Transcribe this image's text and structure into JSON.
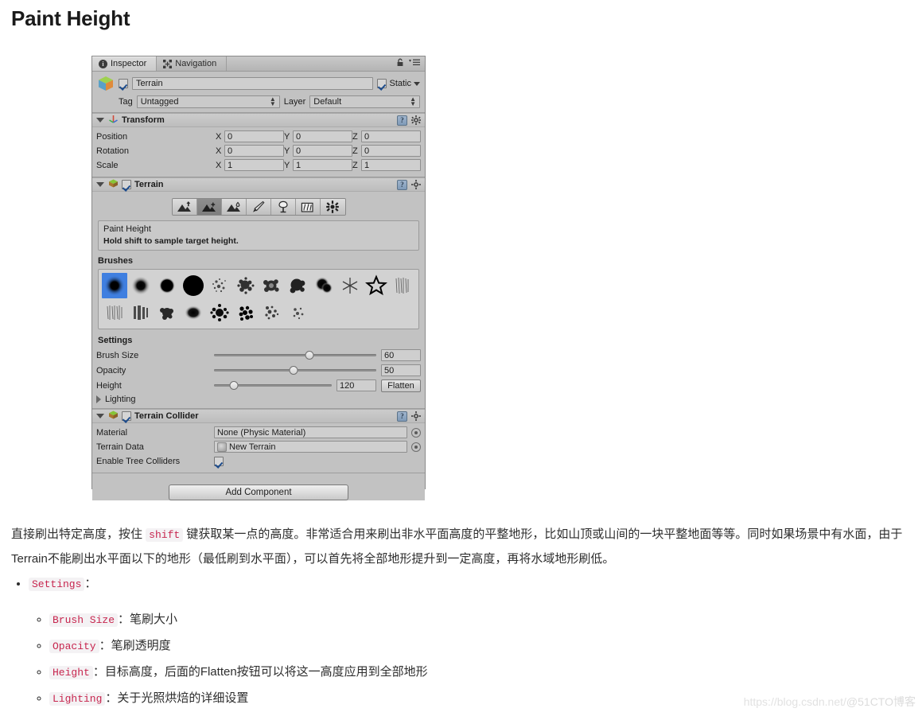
{
  "article": {
    "title": "Paint Height",
    "paragraph_before_code": "直接刷出特定高度，按住 ",
    "paragraph_code": "shift",
    "paragraph_after_code": " 键获取某一点的高度。非常适合用来刷出非水平面高度的平整地形，比如山顶或山间的一块平整地面等等。同时如果场景中有水面，由于Terrain不能刷出水平面以下的地形（最低刷到水平面），可以首先将全部地形提升到一定高度，再将水域地形刷低。",
    "bullets": {
      "top_code": "Settings",
      "top_colon": "：",
      "items": [
        {
          "code": "Brush Size",
          "text": "：笔刷大小"
        },
        {
          "code": "Opacity",
          "text": "：笔刷透明度"
        },
        {
          "code": "Height",
          "text": "：目标高度，后面的Flatten按钮可以将这一高度应用到全部地形"
        },
        {
          "code": "Lighting",
          "text": "：关于光照烘焙的详细设置"
        }
      ]
    },
    "watermark_url": "https://blog.csdn.net/",
    "watermark_brand": "@51CTO博客"
  },
  "inspector": {
    "tabs": [
      {
        "label": "Inspector",
        "icon": "info-icon",
        "active": true
      },
      {
        "label": "Navigation",
        "icon": "navigation-icon",
        "active": false
      }
    ],
    "lock_icon": "lock-icon",
    "menu_icon": "dropdown-menu-icon",
    "object": {
      "enabled": true,
      "name_value": "Terrain",
      "static_label": "Static",
      "static_checked": true,
      "tag_label": "Tag",
      "tag_value": "Untagged",
      "layer_label": "Layer",
      "layer_value": "Default"
    },
    "transform": {
      "title": "Transform",
      "rows": [
        {
          "name": "Position",
          "x": "0",
          "y": "0",
          "z": "0"
        },
        {
          "name": "Rotation",
          "x": "0",
          "y": "0",
          "z": "0"
        },
        {
          "name": "Scale",
          "x": "1",
          "y": "1",
          "z": "1"
        }
      ],
      "axes": [
        "X",
        "Y",
        "Z"
      ]
    },
    "terrain": {
      "title": "Terrain",
      "enabled": true,
      "tools": [
        {
          "name": "raise-lower-terrain-tool",
          "active": false
        },
        {
          "name": "paint-height-tool",
          "active": true
        },
        {
          "name": "smooth-height-tool",
          "active": false
        },
        {
          "name": "paint-texture-tool",
          "active": false
        },
        {
          "name": "place-trees-tool",
          "active": false
        },
        {
          "name": "paint-details-tool",
          "active": false
        },
        {
          "name": "terrain-settings-tool",
          "active": false
        }
      ],
      "help_title": "Paint Height",
      "help_text": "Hold shift to sample target height.",
      "brushes_label": "Brushes",
      "brushes_row1_count": 12,
      "brushes_row2_count": 8,
      "selected_brush_index": 0,
      "selected_brush_color": "#3f7fe0",
      "settings_label": "Settings",
      "settings": [
        {
          "name": "Brush Size",
          "value": "60",
          "percent": 59
        },
        {
          "name": "Opacity",
          "value": "50",
          "percent": 49
        },
        {
          "name": "Height",
          "value": "120",
          "percent": 17
        }
      ],
      "flatten_label": "Flatten",
      "lighting_label": "Lighting"
    },
    "terrain_collider": {
      "title": "Terrain Collider",
      "enabled": true,
      "rows": [
        {
          "name": "Material",
          "value": "None (Physic Material)",
          "type": "object"
        },
        {
          "name": "Terrain Data",
          "value": "New Terrain",
          "type": "object-asset"
        },
        {
          "name": "Enable Tree Colliders",
          "value": "",
          "type": "checkbox",
          "checked": true
        }
      ]
    },
    "add_component_label": "Add Component"
  }
}
